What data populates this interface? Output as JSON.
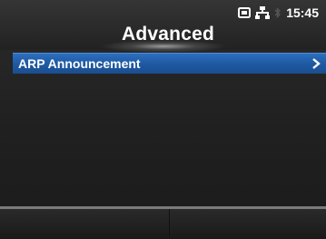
{
  "header": {
    "title": "Advanced",
    "time": "15:45",
    "icons": [
      "card-icon",
      "network-icon",
      "bluetooth-icon"
    ]
  },
  "menu": {
    "items": [
      {
        "label": "ARP Announcement",
        "icon": "chevron-right-icon",
        "selected": true
      }
    ]
  },
  "softkeys": {
    "left": "",
    "right": ""
  },
  "colors": {
    "selection": "#1f5aa3",
    "background": "#202020"
  }
}
